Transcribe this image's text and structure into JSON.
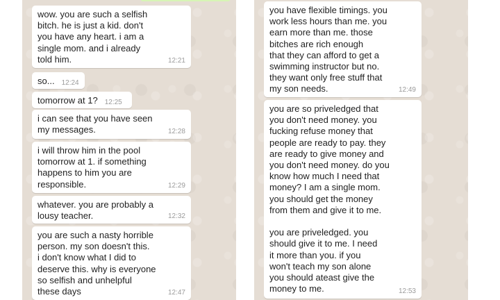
{
  "left_chat": {
    "messages": [
      {
        "text": "wow. you are such a selfish\nbitch. he is just a kid. don't\nyou have any heart. i am a\nsingle mom. and i already\ntold him.",
        "time": "12:21"
      },
      {
        "text": "so...",
        "time": "12:24"
      },
      {
        "text": "tomorrow at 1?",
        "time": "12:25"
      },
      {
        "text": "i can see that you have seen\nmy messages.",
        "time": "12:28"
      },
      {
        "text": "i will throw him in the pool\ntomorrow at 1. if something\nhappens to him you are\nresponsible.",
        "time": "12:29"
      },
      {
        "text": "whatever. you are probably a\nlousy teacher.",
        "time": "12:32"
      },
      {
        "text": "you are such a nasty horrible\nperson. my son doesn't this.\ni don't know what I did to\ndeserve this. why is everyone\nso selfish and unhelpful\nthese days",
        "time": "12:47"
      }
    ]
  },
  "right_chat": {
    "messages": [
      {
        "text": "you have flexible timings. you\nwork less hours than me. you\nearn more than me. those\nbitches are rich enough\nthat they can afford to get a\nswimming instructor but no.\nthey want only free stuff that\nmy son needs.",
        "time": "12:49"
      },
      {
        "text": "you are so priveledged that\nyou don't need money. you\nfucking refuse money that\npeople are ready to pay. they\nare ready to give money and\nyou don't need money. do you\nknow how much I need that\nmoney? I am a single mom.\nyou should get the money\nfrom them and give it to me.\n\nyou are priveledged. you\nshould give it to me. I need\nit more than you. if you\nwon't teach my son alone\nyou should ateast give the\nmoney to me.",
        "time": "12:53"
      }
    ]
  }
}
